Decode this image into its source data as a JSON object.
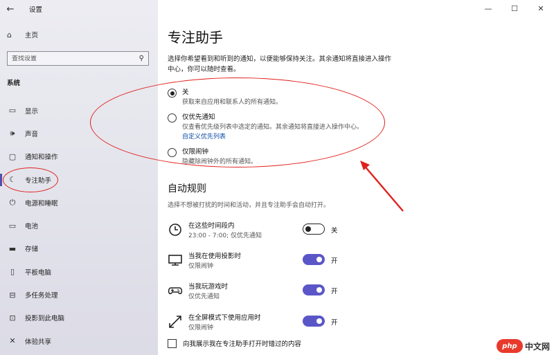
{
  "window": {
    "title": "设置",
    "controls": {
      "minimize": "—",
      "maximize": "☐",
      "close": "✕"
    }
  },
  "sidebar": {
    "back": "←",
    "home": {
      "label": "主页",
      "icon": "home-icon"
    },
    "search": {
      "placeholder": "查找设置",
      "icon": "search-icon"
    },
    "section": "系统",
    "items": [
      {
        "label": "显示",
        "icon": "display-icon",
        "glyph": "▭",
        "active": false
      },
      {
        "label": "声音",
        "icon": "speaker-icon",
        "glyph": "🕪",
        "active": false
      },
      {
        "label": "通知和操作",
        "icon": "notification-icon",
        "glyph": "▢",
        "active": false
      },
      {
        "label": "专注助手",
        "icon": "moon-icon",
        "glyph": "☾",
        "active": true
      },
      {
        "label": "电源和睡眠",
        "icon": "power-icon",
        "glyph": "⏻",
        "active": false
      },
      {
        "label": "电池",
        "icon": "battery-icon",
        "glyph": "▭",
        "active": false
      },
      {
        "label": "存储",
        "icon": "storage-icon",
        "glyph": "▬",
        "active": false
      },
      {
        "label": "平板电脑",
        "icon": "tablet-icon",
        "glyph": "▯",
        "active": false
      },
      {
        "label": "多任务处理",
        "icon": "multitask-icon",
        "glyph": "⊟",
        "active": false
      },
      {
        "label": "投影到此电脑",
        "icon": "project-icon",
        "glyph": "⊡",
        "active": false
      },
      {
        "label": "体验共享",
        "icon": "share-icon",
        "glyph": "✕",
        "active": false
      }
    ]
  },
  "main": {
    "title": "专注助手",
    "intro": "选择你希望看到和听到的通知，以便能够保持关注。其余通知将直接进入操作中心，你可以随时查看。",
    "options": [
      {
        "title": "关",
        "desc": "获取来自应用和联系人的所有通知。",
        "checked": true
      },
      {
        "title": "仅优先通知",
        "desc": "仅查看优先级列表中选定的通知。其余通知将直接进入操作中心。",
        "link": "自定义优先列表",
        "checked": false
      },
      {
        "title": "仅限闹钟",
        "desc": "隐藏除闹钟外的所有通知。",
        "checked": false
      }
    ],
    "auto_rules": {
      "title": "自动规则",
      "desc": "选择不想被打扰的时间和活动，并且专注助手会自动打开。",
      "rules": [
        {
          "title": "在这些时间段内",
          "sub": "23:00 - 7:00; 仅优先通知",
          "state": "关",
          "on": false,
          "icon": "clock-icon"
        },
        {
          "title": "当我在使用投影时",
          "sub": "仅限闹钟",
          "state": "开",
          "on": true,
          "icon": "monitor-icon"
        },
        {
          "title": "当我玩游戏时",
          "sub": "仅优先通知",
          "state": "开",
          "on": true,
          "icon": "gamepad-icon"
        },
        {
          "title": "在全屏模式下使用应用时",
          "sub": "仅限闹钟",
          "state": "开",
          "on": true,
          "icon": "fullscreen-icon"
        }
      ]
    },
    "checkbox": "向我展示我在专注助手打开时错过的内容"
  },
  "watermark": {
    "badge": "php",
    "text": "中文网"
  },
  "colors": {
    "accent": "#5b56c8",
    "annotation": "#e0201d",
    "link": "#0b4aa6"
  }
}
